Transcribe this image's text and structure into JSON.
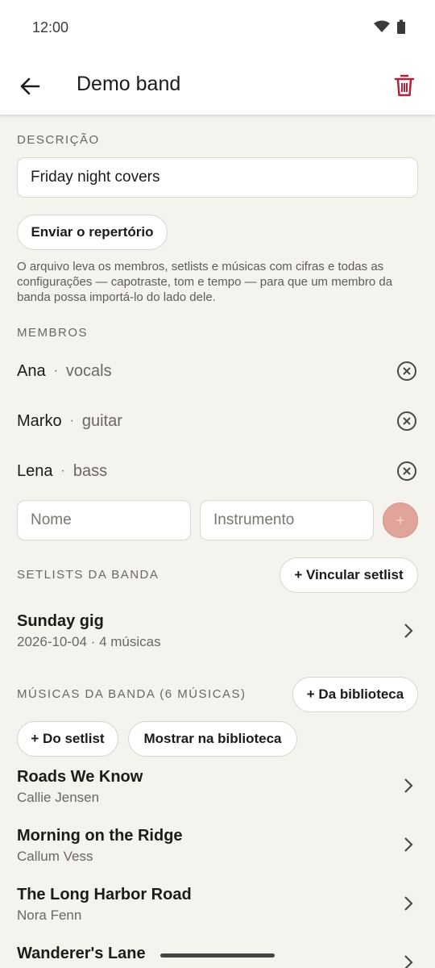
{
  "status": {
    "time": "12:00"
  },
  "appbar": {
    "title": "Demo band"
  },
  "description": {
    "label": "DESCRIÇÃO",
    "value": "Friday night covers"
  },
  "send_button": "Enviar o repertório",
  "help_text": "O arquivo leva os membros, setlists e músicas com cifras e todas as configurações — capotraste, tom e tempo — para que um membro da banda possa importá-lo do lado dele.",
  "members": {
    "label": "MEMBROS",
    "items": [
      {
        "name": "Ana",
        "instrument": "vocals"
      },
      {
        "name": "Marko",
        "instrument": "guitar"
      },
      {
        "name": "Lena",
        "instrument": "bass"
      }
    ],
    "separator": "·",
    "name_placeholder": "Nome",
    "instrument_placeholder": "Instrumento",
    "add_symbol": "+"
  },
  "setlists": {
    "label": "SETLISTS DA BANDA",
    "link_button": "+ Vincular setlist",
    "items": [
      {
        "title": "Sunday gig",
        "subtitle": "2026-10-04  ·  4 músicas"
      }
    ]
  },
  "songs": {
    "label": "MÚSICAS DA BANDA (6 MÚSICAS)",
    "from_library_button": "+ Da biblioteca",
    "from_setlist_button": "+ Do setlist",
    "show_in_library_button": "Mostrar na biblioteca",
    "items": [
      {
        "title": "Roads We Know",
        "artist": "Callie Jensen"
      },
      {
        "title": "Morning on the Ridge",
        "artist": "Callum Vess"
      },
      {
        "title": "The Long Harbor Road",
        "artist": "Nora Fenn"
      },
      {
        "title": "Wanderer's Lane",
        "artist": ""
      }
    ]
  },
  "colors": {
    "accent": "#b3213a",
    "background": "#f5f3ee",
    "add_button": "#e0a49a"
  }
}
